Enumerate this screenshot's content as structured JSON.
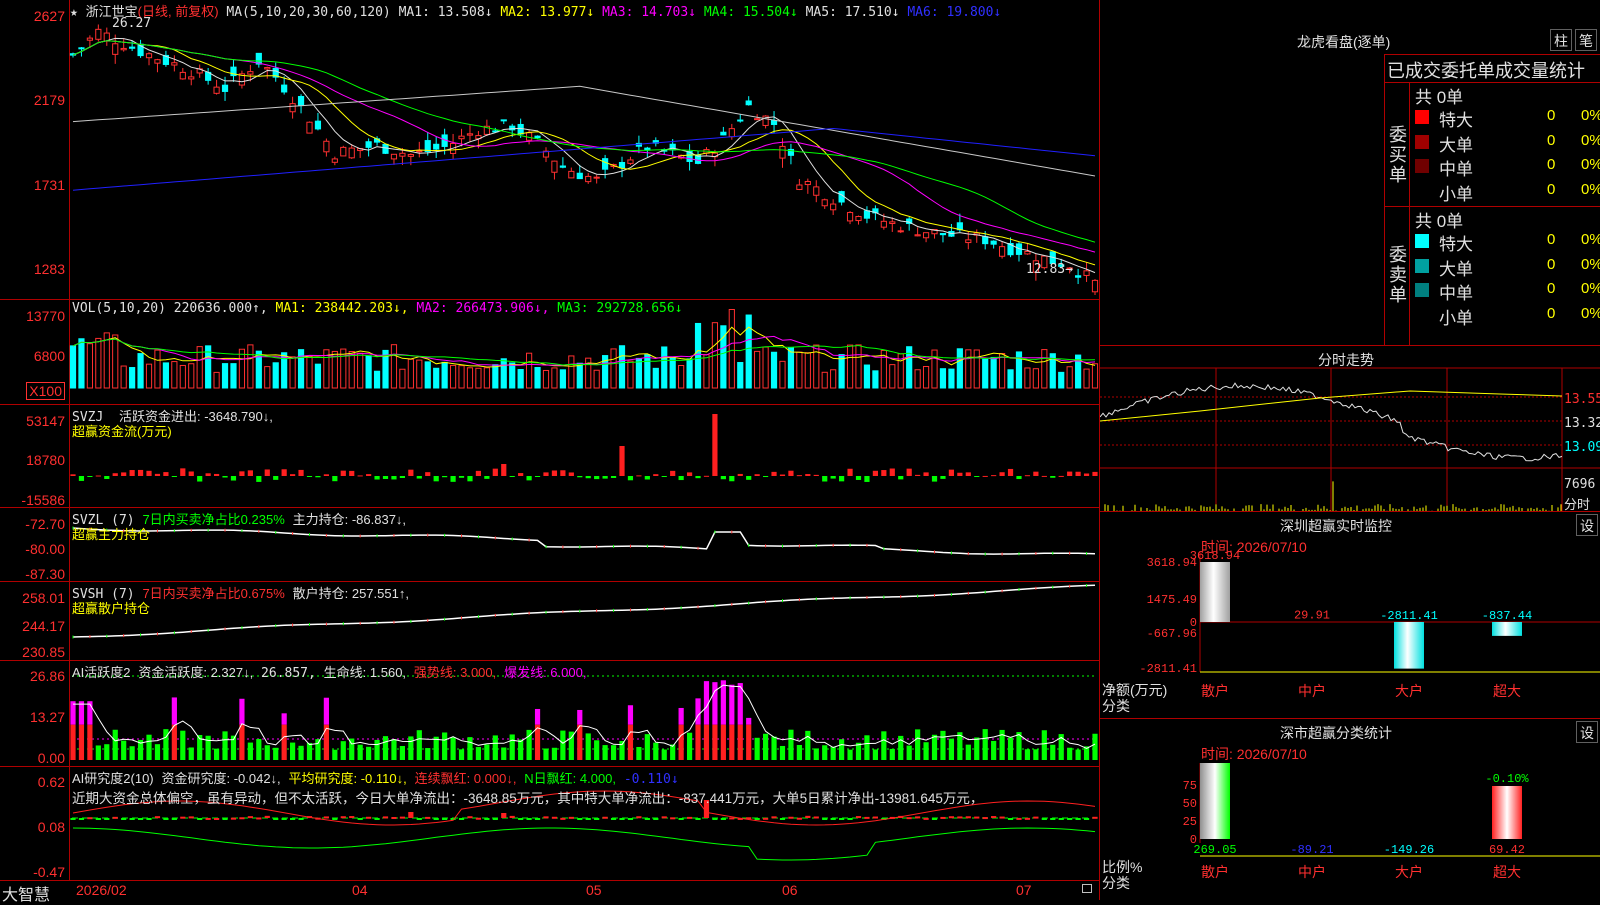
{
  "stock": {
    "name": "浙江世宝",
    "mode": "(日线, 前复权)",
    "ma_label": "MA(5,10,20,30,60,120)",
    "ma1": "MA1: 13.508↓",
    "ma2": "MA2: 13.977↓",
    "ma3": "MA3: 14.703↓",
    "ma4": "MA4: 15.504↓",
    "ma5": "MA5: 17.510↓",
    "ma6": "MA6: 19.800↓",
    "high_mark": "26.27",
    "low_mark": "12.83→",
    "y_ticks": [
      "2627",
      "2179",
      "1731",
      "1283"
    ]
  },
  "vol": {
    "label": "VOL(5,10,20)",
    "value": "220636.000↑,",
    "ma1": "MA1: 238442.203↓,",
    "ma2": "MA2: 266473.906↓,",
    "ma3": "MA3: 292728.656↓",
    "y_ticks": [
      "13770",
      "6800",
      "X100"
    ]
  },
  "svzj": {
    "label": "SVZJ",
    "text": "活跃资金进出: -3648.790↓,",
    "sub": "超赢资金流(万元)",
    "y_ticks": [
      "53147",
      "18780",
      "-15586"
    ]
  },
  "svzl": {
    "label": "SVZL (7)",
    "text1": "7日内买卖净占比0.235%",
    "text2": "主力持仓: -86.837↓,",
    "sub": "超赢主力持仓",
    "y_ticks": [
      "-72.70",
      "-80.00",
      "-87.30"
    ]
  },
  "svsh": {
    "label": "SVSH (7)",
    "text1": "7日内买卖净占比0.675%",
    "text2": "散户持仓: 257.551↑,",
    "sub": "超赢散户持仓",
    "y_ticks": [
      "258.01",
      "244.17",
      "230.85"
    ]
  },
  "ai1": {
    "label": "AI活跃度2",
    "t1": "资金活跃度: 2.327↓,",
    "t2": "26.857,",
    "t3": "生命线: 1.560,",
    "t4": "强势线: 3.000,",
    "t5": "爆发线: 6.000,",
    "y_ticks": [
      "26.86",
      "13.27",
      "0.00"
    ]
  },
  "ai2": {
    "label": "AI研究度2(10)",
    "t1": "资金研究度: -0.042↓,",
    "t2": "平均研究度: -0.110↓,",
    "t3": "连续飘红: 0.000↓,",
    "t4": "N日飘红: 4.000,",
    "t5": "-0.110↓",
    "comment": "近期大资金总体偏空，虽有异动，但不太活跃，今日大单净流出：-3648.85万元，其中特大单净流出：-837.441万元，大单5日累计净出-13981.645万元，",
    "y_ticks": [
      "0.62",
      "0.08",
      "-0.47"
    ]
  },
  "dates": {
    "brand": "大智慧",
    "labels": [
      "2026/02",
      "04",
      "05",
      "06",
      "07"
    ]
  },
  "lhb": {
    "title": "龙虎看盘(逐单)",
    "btn1": "柱",
    "btn2": "笔",
    "subtitle": "已成交委托单成交量统计",
    "buy_side": "委买单",
    "sell_side": "委卖单",
    "buy_total": "共 0单",
    "sell_total": "共 0单",
    "buy_rows": [
      {
        "label": "特大",
        "count": "0",
        "pct": "0%",
        "color": "#ff0000"
      },
      {
        "label": "大单",
        "count": "0",
        "pct": "0%",
        "color": "#a00000"
      },
      {
        "label": "中单",
        "count": "0",
        "pct": "0%",
        "color": "#700000"
      },
      {
        "label": "小单",
        "count": "0",
        "pct": "0%",
        "color": "#000000"
      }
    ],
    "sell_rows": [
      {
        "label": "特大",
        "count": "0",
        "pct": "0%",
        "color": "#00ffff"
      },
      {
        "label": "大单",
        "count": "0",
        "pct": "0%",
        "color": "#00a0a0"
      },
      {
        "label": "中单",
        "count": "0",
        "pct": "0%",
        "color": "#008080"
      },
      {
        "label": "小单",
        "count": "0",
        "pct": "0%",
        "color": "#000000"
      }
    ]
  },
  "intraday": {
    "title": "分时走势",
    "prices": [
      "13.55",
      "13.32",
      "13.09"
    ],
    "vol": "7696",
    "unit": "分时"
  },
  "szmon": {
    "title": "深圳超赢实时监控",
    "set": "设",
    "time": "时间: 2026/07/10",
    "y_ticks": [
      "3618.94",
      "1475.49",
      "0",
      "-667.96",
      "-2811.41"
    ],
    "ylabel": "净额(万元)",
    "xlabel": "分类",
    "bars": [
      {
        "name": "散户",
        "value": "3618.94"
      },
      {
        "name": "中户",
        "value": "29.91"
      },
      {
        "name": "大户",
        "value": "-2811.41"
      },
      {
        "name": "超大",
        "value": "-837.44"
      }
    ]
  },
  "szcls": {
    "title": "深市超赢分类统计",
    "set": "设",
    "time": "时间: 2026/07/10",
    "y_ticks": [
      "75",
      "50",
      "25",
      "0"
    ],
    "ylabel": "比例%",
    "xlabel": "分类",
    "top_label": "-0.10%",
    "bars": [
      {
        "name": "散户",
        "value": "269.05"
      },
      {
        "name": "中户",
        "value": "-89.21"
      },
      {
        "name": "大户",
        "value": "-149.26"
      },
      {
        "name": "超大",
        "value": "69.42"
      }
    ]
  }
}
